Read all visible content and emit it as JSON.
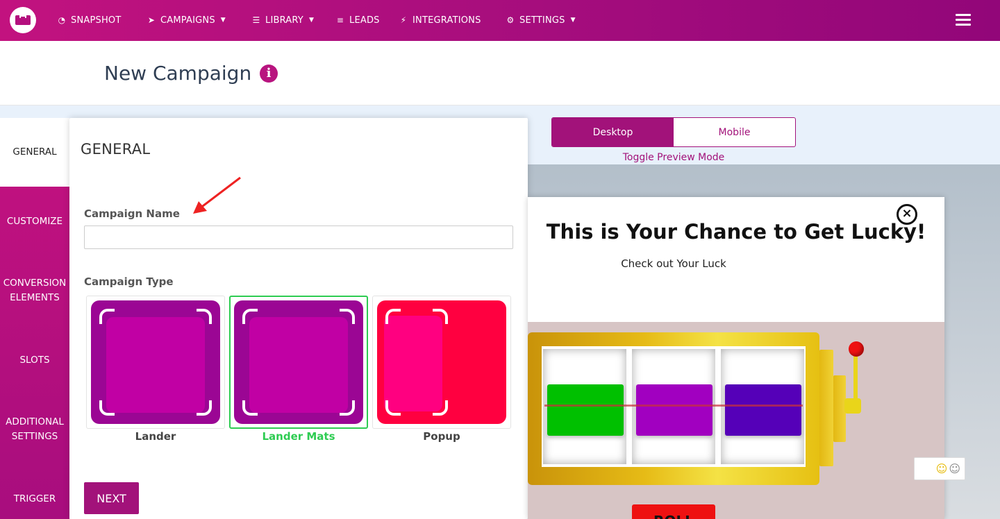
{
  "nav": {
    "items": [
      {
        "label": "SNAPSHOT",
        "icon": "dashboard-icon",
        "caret": false
      },
      {
        "label": "CAMPAIGNS",
        "icon": "paper-plane-icon",
        "caret": true
      },
      {
        "label": "LIBRARY",
        "icon": "server-icon",
        "caret": true
      },
      {
        "label": "LEADS",
        "icon": "list-icon",
        "caret": false
      },
      {
        "label": "INTEGRATIONS",
        "icon": "plug-icon",
        "caret": false
      },
      {
        "label": "SETTINGS",
        "icon": "gears-icon",
        "caret": true
      }
    ]
  },
  "header": {
    "title": "New Campaign",
    "info_glyph": "i"
  },
  "sidebar": {
    "tabs": [
      {
        "label": "GENERAL",
        "active": true
      },
      {
        "label": "CUSTOMIZE",
        "active": false
      },
      {
        "label": "CONVERSION ELEMENTS",
        "active": false
      },
      {
        "label": "SLOTS",
        "active": false
      },
      {
        "label": "ADDITIONAL SETTINGS",
        "active": false
      },
      {
        "label": "TRIGGER",
        "active": false
      }
    ]
  },
  "panel": {
    "title": "GENERAL",
    "campaign_name_label": "Campaign Name",
    "campaign_name_value": "",
    "campaign_type_label": "Campaign Type",
    "types": [
      {
        "label": "Lander",
        "selected": false
      },
      {
        "label": "Lander Mats",
        "selected": true
      },
      {
        "label": "Popup",
        "selected": false
      }
    ],
    "next_label": "NEXT"
  },
  "preview": {
    "toggle": {
      "desktop": "Desktop",
      "mobile": "Mobile",
      "active": "desktop"
    },
    "caption": "Toggle Preview Mode",
    "popup_title": "This is Your Chance to Get Lucky!",
    "popup_subtitle": "Check out Your Luck",
    "close_glyph": "×",
    "roll_label": "ROLL",
    "reel_colors": [
      "#00c000",
      "#a100c0",
      "#5500b8"
    ]
  },
  "colors": {
    "brand": "#a2127a",
    "accent_green": "#2ecc52",
    "lander_outer": "#9b0694",
    "lander_inner": "#c100a4",
    "popup_outer": "#ff0040",
    "popup_inner": "#ff0080"
  }
}
